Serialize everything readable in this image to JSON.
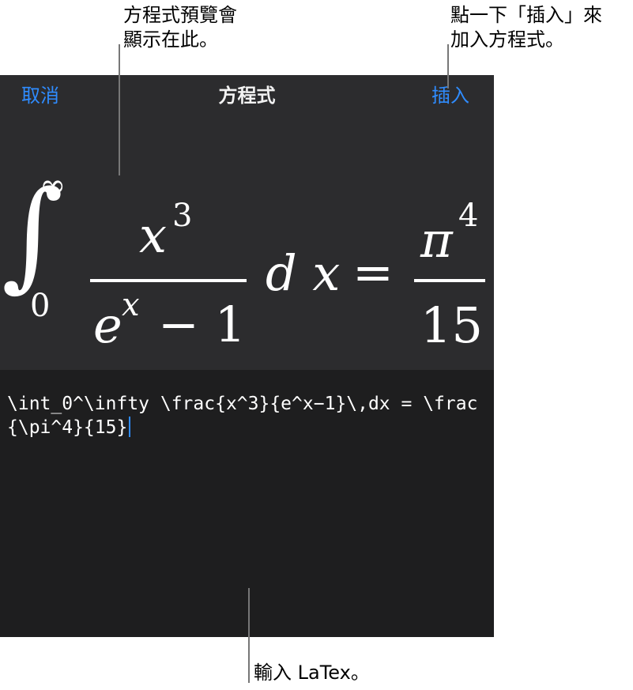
{
  "callouts": {
    "preview_line1": "方程式預覽會",
    "preview_line2": "顯示在此。",
    "insert_line1": "點一下「插入」來",
    "insert_line2": "加入方程式。",
    "latex": "輸入 LaTex。"
  },
  "nav": {
    "cancel_label": "取消",
    "title": "方程式",
    "insert_label": "插入"
  },
  "equation": {
    "integral_sign": "∫",
    "upper_limit": "∞",
    "lower_limit": "0",
    "numerator_base": "x",
    "numerator_exp": "3",
    "denominator_base": "e",
    "denominator_exp": "x",
    "denominator_rest": "− 1",
    "differential": "d x",
    "equals": "=",
    "rhs_base": "π",
    "rhs_exp": "4",
    "rhs_denominator": "15"
  },
  "editor": {
    "latex_value": "\\int_0^\\infty \\frac{x^3}{e^x−1}\\,dx = \\frac{\\pi^4}{15}"
  },
  "colors": {
    "accent": "#2f8cff",
    "nav_background": "#2c2c2e",
    "editor_background": "#1e1e1f"
  }
}
